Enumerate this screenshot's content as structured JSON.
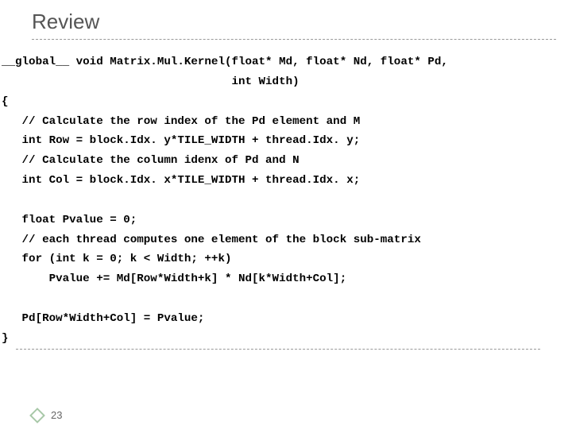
{
  "title": "Review",
  "code": {
    "l1": "__global__ void Matrix.Mul.Kernel(float* Md, float* Nd, float* Pd,",
    "l2": "                                  int Width)",
    "l3": "{",
    "l4": "   // Calculate the row index of the Pd element and M",
    "l5": "   int Row = block.Idx. y*TILE_WIDTH + thread.Idx. y;",
    "l6": "   // Calculate the column idenx of Pd and N",
    "l7": "   int Col = block.Idx. x*TILE_WIDTH + thread.Idx. x;",
    "l8": "",
    "l9": "   float Pvalue = 0;",
    "l10": "   // each thread computes one element of the block sub-matrix",
    "l11": "   for (int k = 0; k < Width; ++k)",
    "l12": "       Pvalue += Md[Row*Width+k] * Nd[k*Width+Col];",
    "l13": "",
    "l14": "   Pd[Row*Width+Col] = Pvalue;",
    "l15": "}"
  },
  "page_number": "23"
}
